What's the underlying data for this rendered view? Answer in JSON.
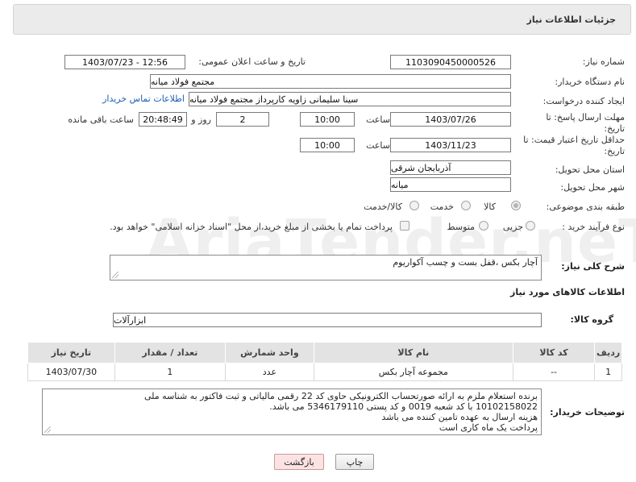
{
  "header": {
    "title": "جزئیات اطلاعات نیاز"
  },
  "fields": {
    "need_number_label": "شماره نیاز:",
    "need_number": "1103090450000526",
    "announce_label": "تاریخ و ساعت اعلان عمومی:",
    "announce_value": "1403/07/23 - 12:56",
    "buyer_org_label": "نام دستگاه خریدار:",
    "buyer_org": "مجتمع فولاد میانه",
    "creator_label": "ایجاد کننده درخواست:",
    "creator": "سینا سلیمانی زاویه کارپرداز مجتمع فولاد میانه",
    "contact_link": "اطلاعات تماس خریدار",
    "deadline_label": "مهلت ارسال پاسخ: تا",
    "deadline_label2": "تاریخ:",
    "deadline_date": "1403/07/26",
    "time_label": "ساعت",
    "deadline_time": "10:00",
    "days_value": "2",
    "days_label": "روز و",
    "remaining_value": "20:48:49",
    "remaining_label": "ساعت باقی مانده",
    "validity_label": "حداقل تاریخ اعتبار قیمت: تا",
    "validity_label2": "تاریخ:",
    "validity_date": "1403/11/23",
    "validity_time": "10:00",
    "province_label": "استان محل تحویل:",
    "province": "آذربایجان شرقی",
    "city_label": "شهر محل تحویل:",
    "city": "میانه",
    "category_label": "طبقه بندی موضوعی:",
    "category_options": [
      "کالا",
      "خدمت",
      "کالا/خدمت"
    ],
    "category_selected": "کالا",
    "process_label": "نوع فرآیند خرید :",
    "process_options": [
      "جزیی",
      "متوسط"
    ],
    "process_note": "پرداخت تمام یا بخشی از مبلغ خرید،از محل \"اسناد خزانه اسلامی\" خواهد بود."
  },
  "description": {
    "label": "شرح کلی نیاز:",
    "value": "آچار بکس ،قفل بست و چسب آکواریوم"
  },
  "goods_section": {
    "title": "اطلاعات کالاهای مورد نیاز",
    "group_label": "گروه کالا:",
    "group_value": "ابزارآلات"
  },
  "table": {
    "headers": [
      "ردیف",
      "کد کالا",
      "نام کالا",
      "واحد شمارش",
      "تعداد / مقدار",
      "تاریخ نیاز"
    ],
    "rows": [
      [
        "1",
        "--",
        "مجموعه آچار بکس",
        "عدد",
        "1",
        "1403/07/30"
      ]
    ]
  },
  "buyer_notes": {
    "label": "توضیحات خریدار:",
    "lines": [
      "برنده استعلام ملزم به ارائه صورتحساب الکترونیکی حاوی کد 22 رقمی مالیاتی و  ثبت     فاکتور به شناسه ملی",
      "10102158022 با کد شعبه 0019    و کد پستی 5346179110 می باشد.",
      "هزینه ارسال به عهده تامین کننده می باشد",
      "پرداخت یک ماه کاری است"
    ]
  },
  "buttons": {
    "print": "چاپ",
    "back": "بازگشت"
  },
  "watermark": "AriaTender.neT"
}
